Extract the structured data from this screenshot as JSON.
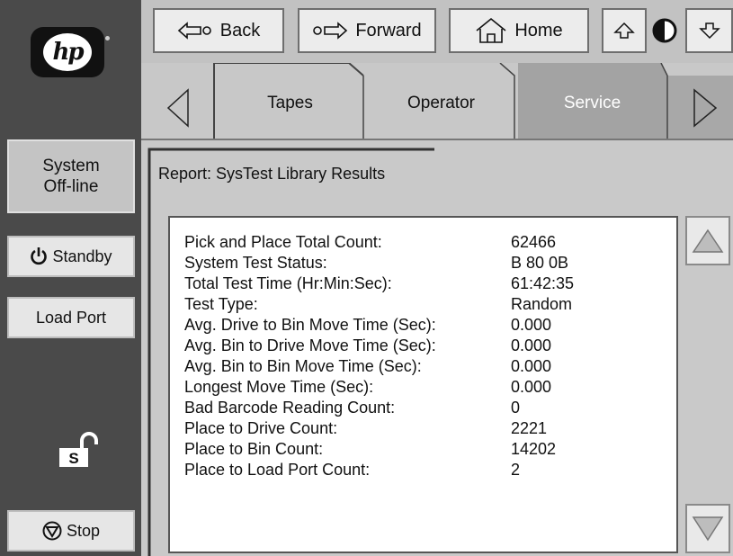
{
  "sidebar": {
    "logo_text": "hp",
    "system_status_line1": "System",
    "system_status_line2": "Off-line",
    "standby_label": "Standby",
    "load_port_label": "Load Port",
    "lock_letter": "S",
    "stop_label": "Stop"
  },
  "nav": {
    "back_label": "Back",
    "forward_label": "Forward",
    "home_label": "Home"
  },
  "tabs": [
    {
      "label": "Tapes",
      "active": false
    },
    {
      "label": "Operator",
      "active": false
    },
    {
      "label": "Service",
      "active": true
    }
  ],
  "report": {
    "title": "Report: SysTest Library Results",
    "rows": [
      {
        "label": "Pick and Place Total Count:",
        "value": "62466"
      },
      {
        "label": "System Test Status:",
        "value": "B 80 0B"
      },
      {
        "label": "Total Test Time (Hr:Min:Sec):",
        "value": "61:42:35"
      },
      {
        "label": "Test Type:",
        "value": "Random"
      },
      {
        "label": "Avg. Drive to Bin Move Time (Sec):",
        "value": "0.000"
      },
      {
        "label": "Avg. Bin to Drive Move Time (Sec):",
        "value": "0.000"
      },
      {
        "label": "Avg. Bin to Bin Move Time (Sec):",
        "value": "0.000"
      },
      {
        "label": "Longest Move Time (Sec):",
        "value": "0.000"
      },
      {
        "label": "Bad Barcode Reading Count:",
        "value": "0"
      },
      {
        "label": "Place to Drive Count:",
        "value": "2221"
      },
      {
        "label": "Place to Bin Count:",
        "value": "14202"
      },
      {
        "label": "Place to Load Port Count:",
        "value": "2"
      }
    ]
  },
  "icons": {
    "back": "back-arrow-icon",
    "forward": "forward-arrow-icon",
    "home": "home-icon",
    "up": "up-arrow-icon",
    "down": "down-arrow-icon",
    "contrast": "contrast-icon",
    "standby": "power-icon",
    "stop": "stop-icon",
    "lock": "unlocked-padlock-icon",
    "tab_prev": "left-triangle-icon",
    "tab_next": "right-triangle-icon",
    "scroll_up": "scroll-up-triangle-icon",
    "scroll_down": "scroll-down-triangle-icon"
  },
  "colors": {
    "sidebar": "#4a4a4a",
    "active_tab": "#a3a3a3",
    "panel": "#c9c9c9"
  }
}
